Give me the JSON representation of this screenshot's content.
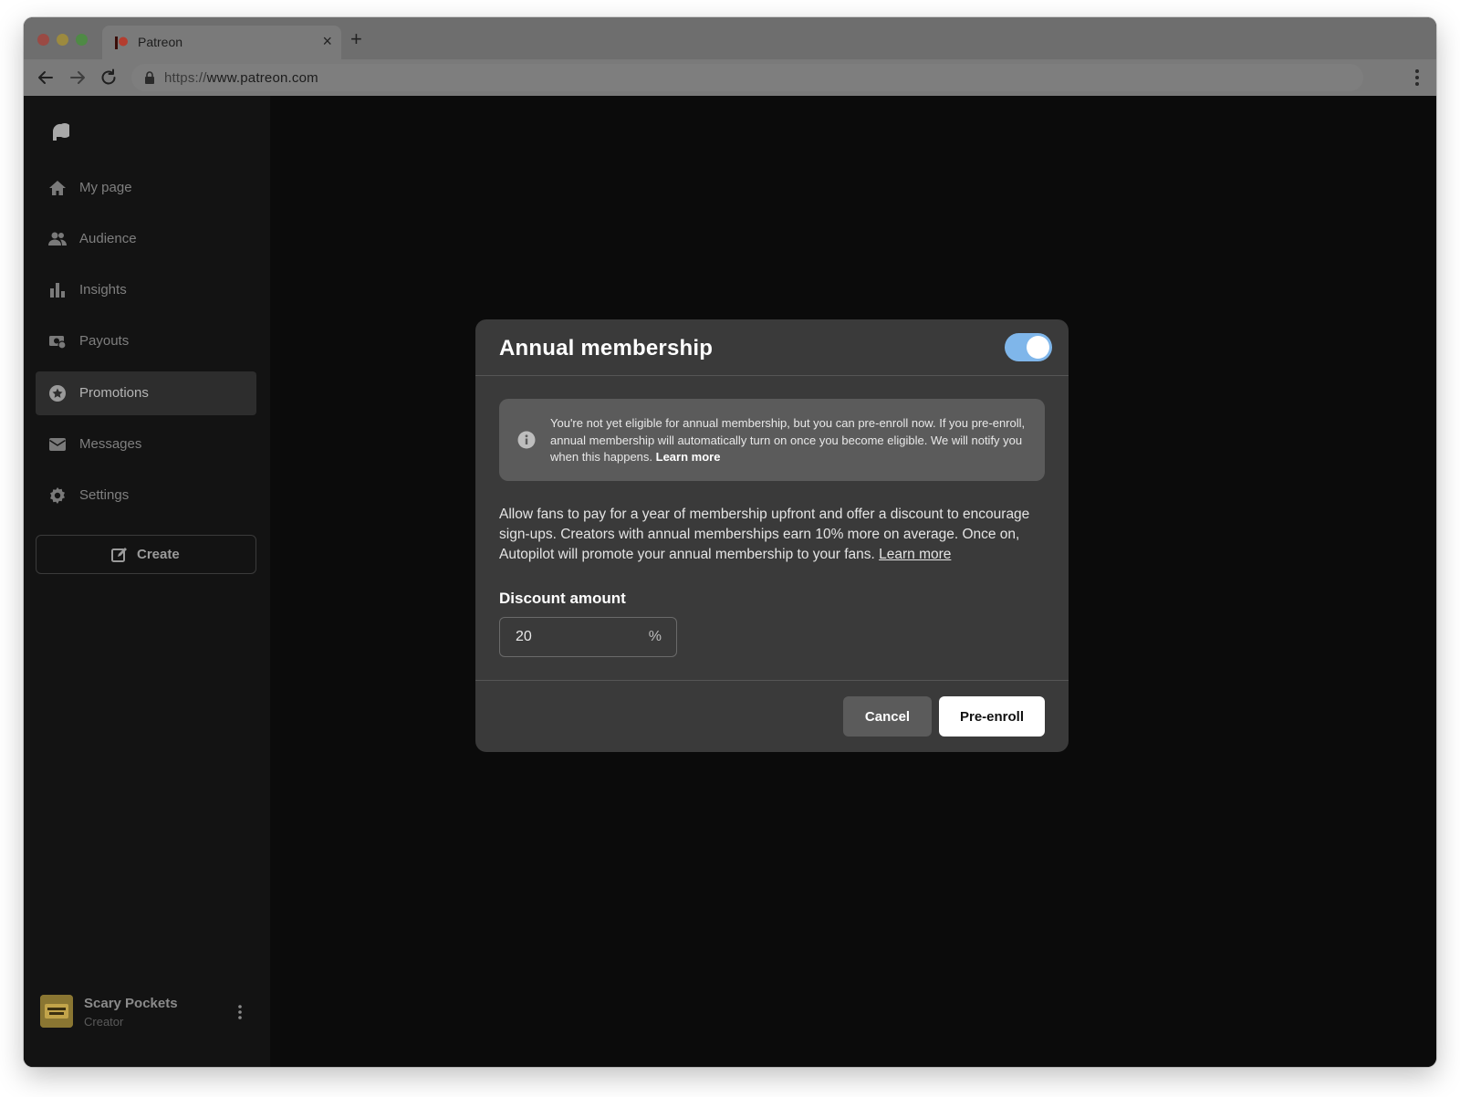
{
  "browser": {
    "tab_title": "Patreon",
    "url_scheme": "https://",
    "url_host": "www.patreon.com"
  },
  "sidebar": {
    "items": [
      {
        "label": "My page",
        "icon": "home-icon"
      },
      {
        "label": "Audience",
        "icon": "people-icon"
      },
      {
        "label": "Insights",
        "icon": "bar-chart-icon"
      },
      {
        "label": "Payouts",
        "icon": "money-icon"
      },
      {
        "label": "Promotions",
        "icon": "star-badge-icon",
        "active": true
      },
      {
        "label": "Messages",
        "icon": "envelope-icon"
      },
      {
        "label": "Settings",
        "icon": "gear-icon"
      }
    ],
    "create_label": "Create",
    "user": {
      "name": "Scary Pockets",
      "role": "Creator"
    }
  },
  "modal": {
    "title": "Annual membership",
    "toggle_on": true,
    "notice_text": "You're not yet eligible for annual membership, but you can pre-enroll now. If you pre-enroll, annual membership will automatically turn on once you become eligible. We will notify you when this happens. ",
    "notice_link": "Learn more",
    "description": "Allow fans to pay for a year of membership upfront and offer a discount to encourage sign-ups. Creators with annual memberships earn 10% more on average. Once on, Autopilot will promote your annual membership to your fans. ",
    "description_link": "Learn more",
    "discount_label": "Discount amount",
    "discount_value": "20",
    "discount_suffix": "%",
    "cancel_label": "Cancel",
    "primary_label": "Pre-enroll"
  },
  "colors": {
    "toggle_accent": "#7fb6ea",
    "sidebar_bg": "#131313",
    "modal_bg": "#3a3a3a"
  }
}
